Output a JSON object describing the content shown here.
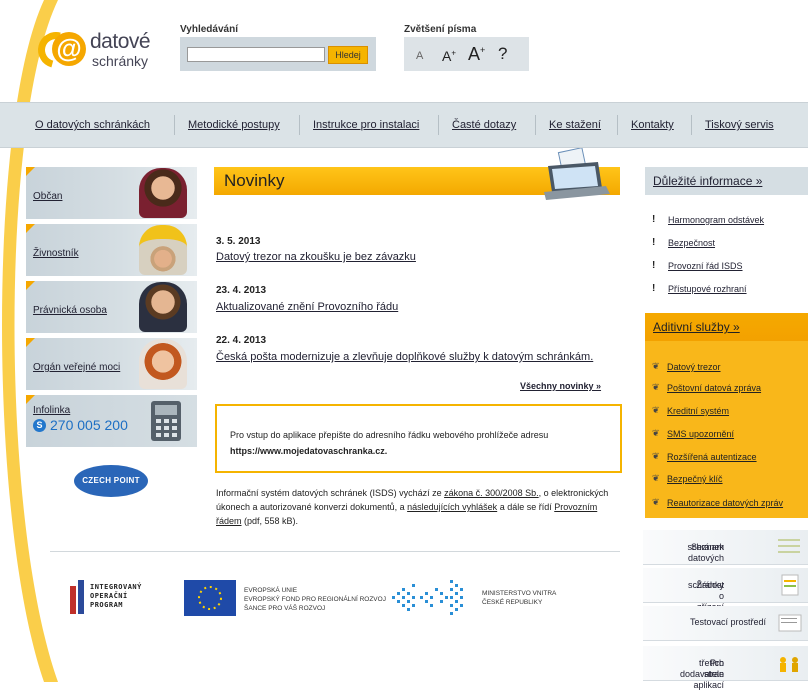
{
  "header": {
    "logo_line1": "datové",
    "logo_line2": "schránky",
    "search_label": "Vyhledávání",
    "search_value": "",
    "search_button": "Hledej",
    "font_label": "Zvětšení písma",
    "font_buttons": [
      "A",
      "A",
      "A",
      "?"
    ]
  },
  "nav": {
    "items": [
      "O datových schránkách",
      "Metodické postupy",
      "Instrukce pro instalaci",
      "Časté dotazy",
      "Ke stažení",
      "Kontakty",
      "Tiskový servis"
    ]
  },
  "left": {
    "cards": [
      "Občan",
      "Živnostník",
      "Právnická osoba",
      "Orgán veřejné moci"
    ],
    "infolinka_label": "Infolinka",
    "infolinka_number": "270 005 200",
    "czechpoint": "CZECH POINT"
  },
  "center": {
    "novinky_title": "Novinky",
    "news": [
      {
        "date": "3. 5. 2013",
        "title": "Datový trezor na zkoušku je bez závazku"
      },
      {
        "date": "23. 4. 2013",
        "title": "Aktualizované znění Provozního řádu"
      },
      {
        "date": "22. 4. 2013",
        "title": "Česká pošta modernizuje a zlevňuje doplňkové služby k datovým schránkám."
      }
    ],
    "all_news": "Všechny novinky »",
    "notice_line1": "Pro vstup do aplikace přepište do adresního řádku webového prohlížeče adresu",
    "notice_line2": "https://www.mojedatovaschranka.cz.",
    "info": {
      "p1": "Informační systém datových schránek (ISDS) vychází ze ",
      "link1": "zákona č. 300/2008 Sb.",
      "p2": ", o elektronických úkonech a autorizované konverzi dokumentů, a ",
      "link2": "následujících vyhlášek",
      "p3": " a dále se řídí ",
      "link3": "Provozním řádem",
      "p4": " (pdf, 558 kB)."
    },
    "footer_logos": {
      "iop": [
        "INTEGROVANÝ",
        "OPERAČNÍ",
        "PROGRAM"
      ],
      "eu": [
        "EVROPSKÁ UNIE",
        "EVROPSKÝ FOND PRO REGIONÁLNÍ ROZVOJ",
        "ŠANCE PRO VÁŠ ROZVOJ"
      ],
      "mv": [
        "MINISTERSTVO VNITRA",
        "ČESKÉ REPUBLIKY"
      ]
    }
  },
  "right": {
    "important_title": "Důležité informace »",
    "important_items": [
      "Harmonogram odstávek",
      "Bezpečnost",
      "Provozní řád ISDS",
      "Přístupové rozhraní"
    ],
    "aditiv_title": "Aditivní služby »",
    "aditiv_items": [
      "Datový trezor",
      "Poštovní datová zpráva",
      "Kreditní systém",
      "SMS upozornění",
      "Rozšířená autentizace",
      "Bezpečný klíč",
      "Reautorizace datových zpráv"
    ],
    "boxes": [
      {
        "line1": "Seznam datových",
        "line2": "schránek"
      },
      {
        "line1": "Žádost o zřízení datové",
        "line2": "schránky"
      },
      {
        "line1": "Testovací prostředí",
        "line2": ""
      },
      {
        "line1": "Pro dodavatele aplikací",
        "line2": "třetích stran"
      }
    ]
  },
  "colors": {
    "accent": "#f5b400",
    "panel": "#d5dee3",
    "text": "#222222"
  }
}
